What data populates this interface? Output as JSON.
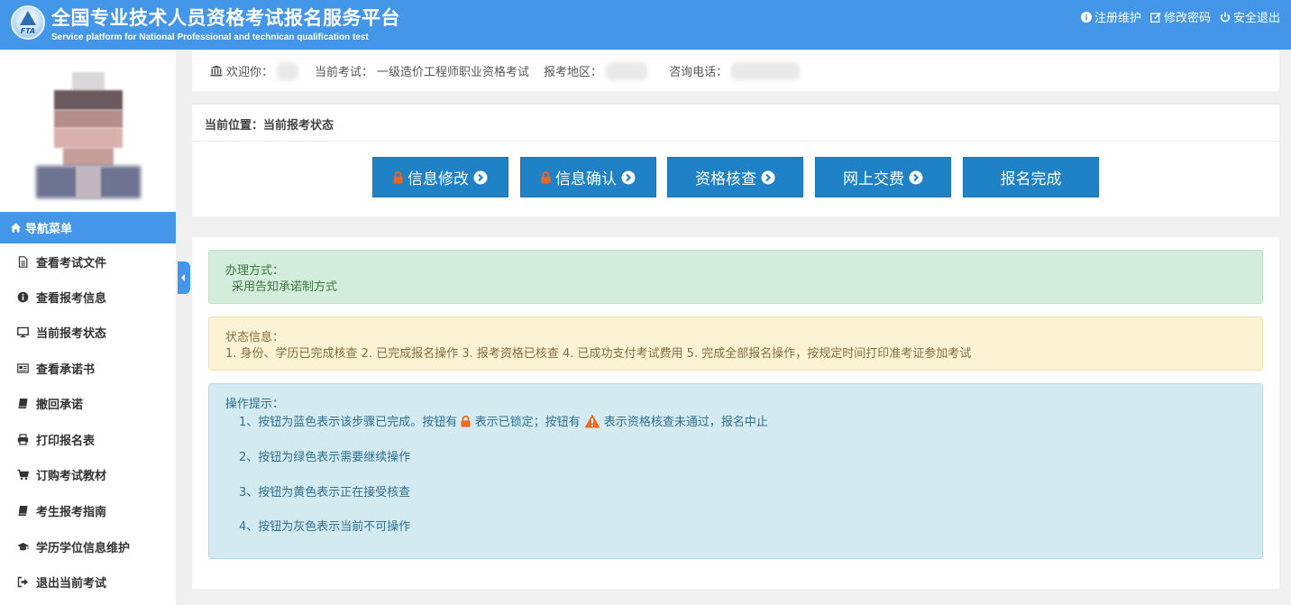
{
  "header": {
    "title": "全国专业技术人员资格考试报名服务平台",
    "subtitle": "Service platform for National Professional and technican qualification test",
    "logo_text": "FTA",
    "links": [
      {
        "label": "注册维护",
        "icon": "info-circle-icon"
      },
      {
        "label": "修改密码",
        "icon": "edit-icon"
      },
      {
        "label": "安全退出",
        "icon": "power-icon"
      }
    ]
  },
  "info_bar": {
    "welcome": "欢迎你：",
    "current_exam_label": "当前考试：",
    "current_exam_value": "一级造价工程师职业资格考试",
    "region_label": "报考地区：",
    "phone_label": "咨询电话："
  },
  "sidebar": {
    "nav_title": "导航菜单",
    "items": [
      {
        "label": "查看考试文件",
        "icon": "file-icon"
      },
      {
        "label": "查看报考信息",
        "icon": "info-circle-icon"
      },
      {
        "label": "当前报考状态",
        "icon": "monitor-icon"
      },
      {
        "label": "查看承诺书",
        "icon": "newspaper-icon"
      },
      {
        "label": "撤回承诺",
        "icon": "book-icon"
      },
      {
        "label": "打印报名表",
        "icon": "print-icon"
      },
      {
        "label": "订购考试教材",
        "icon": "cart-icon"
      },
      {
        "label": "考生报考指南",
        "icon": "book-icon"
      },
      {
        "label": "学历学位信息维护",
        "icon": "graduation-cap-icon"
      },
      {
        "label": "退出当前考试",
        "icon": "sign-out-icon"
      }
    ]
  },
  "steps": {
    "breadcrumb": "当前位置：当前报考状态",
    "buttons": [
      {
        "label": "信息修改",
        "locked": true,
        "arrow": true
      },
      {
        "label": "信息确认",
        "locked": true,
        "arrow": true
      },
      {
        "label": "资格核查",
        "locked": false,
        "arrow": true
      },
      {
        "label": "网上交费",
        "locked": false,
        "arrow": true
      },
      {
        "label": "报名完成",
        "locked": false,
        "arrow": false
      }
    ],
    "color": "#1f82c6"
  },
  "notices": {
    "method": {
      "title": "办理方式：",
      "text": "采用告知承诺制方式"
    },
    "status": {
      "title": "状态信息：",
      "text": "1. 身份、学历已完成核查 2. 已完成报名操作 3. 报考资格已核查 4. 已成功支付考试费用 5. 完成全部报名操作，按规定时间打印准考证参加考试"
    },
    "tips": {
      "title": "操作提示：",
      "line1_a": "1、按钮为蓝色表示该步骤已完成。按钮有",
      "line1_b": "表示已锁定；按钮有",
      "line1_c": "表示资格核查未通过，报名中止",
      "line2": "2、按钮为绿色表示需要继续操作",
      "line3": "3、按钮为黄色表示正在接受核查",
      "line4": "4、按钮为灰色表示当前不可操作"
    }
  },
  "colors": {
    "header": "#4496e8",
    "lock": "#f0661e",
    "warning": "#f0661e"
  }
}
